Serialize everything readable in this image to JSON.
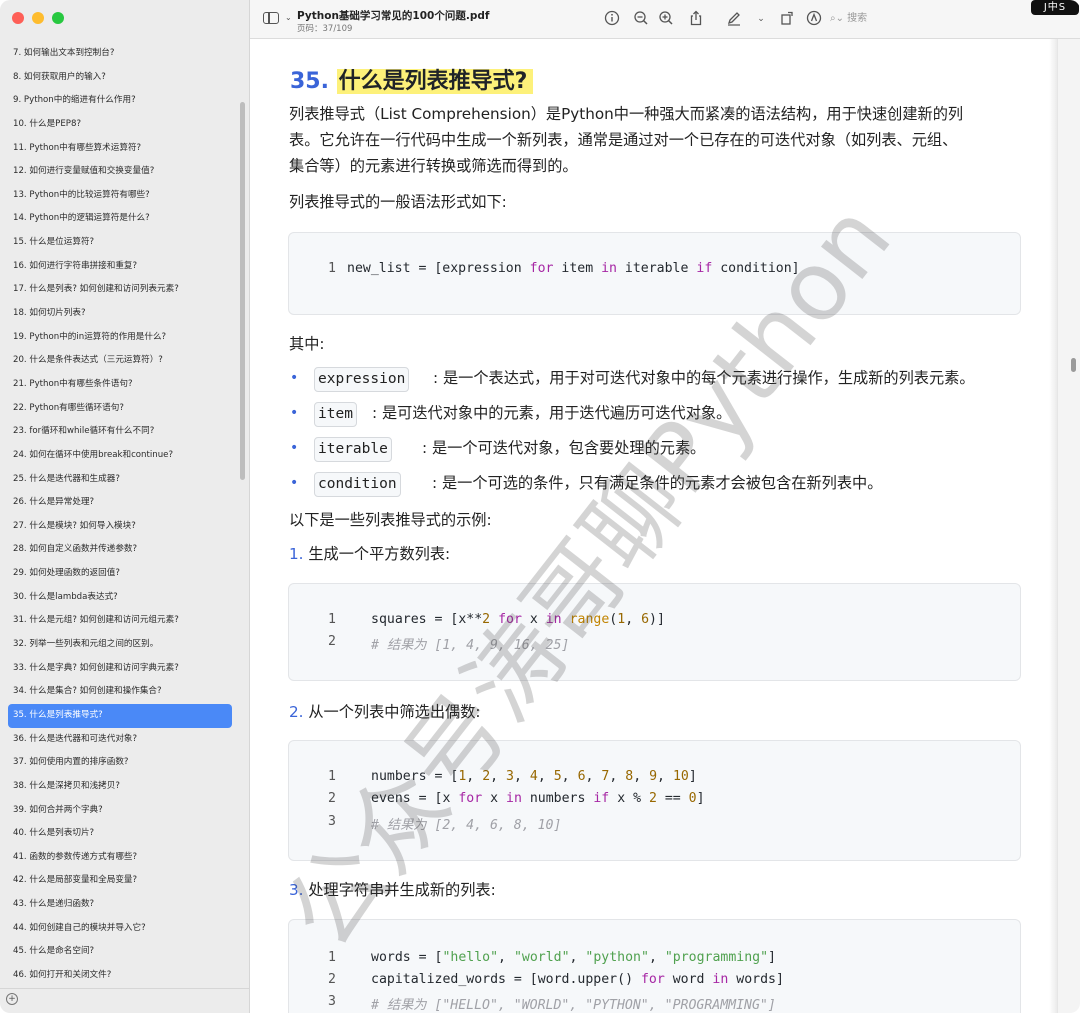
{
  "window": {
    "doc_title": "Python基础学习常见的100个问题.pdf",
    "page_indicator": "页码：37/109",
    "search_placeholder": "搜索",
    "ext_badge": "J中S"
  },
  "sidebar": {
    "items": [
      "7. 如何输出文本到控制台?",
      "8. 如何获取用户的输入?",
      "9. Python中的缩进有什么作用?",
      "10. 什么是PEP8?",
      "11. Python中有哪些算术运算符?",
      "12. 如何进行变量赋值和交换变量值?",
      "13. Python中的比较运算符有哪些?",
      "14. Python中的逻辑运算符是什么?",
      "15. 什么是位运算符?",
      "16. 如何进行字符串拼接和重复?",
      "17. 什么是列表? 如何创建和访问列表元素?",
      "18. 如何切片列表?",
      "19. Python中的in运算符的作用是什么?",
      "20. 什么是条件表达式（三元运算符）?",
      "21. Python中有哪些条件语句?",
      "22. Python有哪些循环语句?",
      "23. for循环和while循环有什么不同?",
      "24. 如何在循环中使用break和continue?",
      "25. 什么是迭代器和生成器?",
      "26. 什么是异常处理?",
      "27. 什么是模块? 如何导入模块?",
      "28. 如何自定义函数并传递参数?",
      "29. 如何处理函数的返回值?",
      "30. 什么是lambda表达式?",
      "31. 什么是元组? 如何创建和访问元组元素?",
      "32. 列举一些列表和元组之间的区别。",
      "33. 什么是字典? 如何创建和访问字典元素?",
      "34. 什么是集合? 如何创建和操作集合?",
      "35. 什么是列表推导式?",
      "36. 什么是迭代器和可迭代对象?",
      "37. 如何使用内置的排序函数?",
      "38. 什么是深拷贝和浅拷贝?",
      "39. 如何合并两个字典?",
      "40. 什么是列表切片?",
      "41. 函数的参数传递方式有哪些?",
      "42. 什么是局部变量和全局变量?",
      "43. 什么是递归函数?",
      "44. 如何创建自己的模块并导入它?",
      "45. 什么是命名空间?",
      "46. 如何打开和关闭文件?"
    ],
    "active_index": 28
  },
  "content": {
    "heading_num": "35.",
    "heading_text": "什么是列表推导式?",
    "intro_line1": "列表推导式（List Comprehension）是Python中一种强大而紧凑的语法结构，用于快速创建新的列",
    "intro_line2": "表。它允许在一行代码中生成一个新列表，通常是通过对一个已存在的可迭代对象（如列表、元组、",
    "intro_line3": "集合等）的元素进行转换或筛选而得到的。",
    "syntax_intro": "列表推导式的一般语法形式如下:",
    "syntax_code": {
      "ln": "1",
      "a": "new_list = [expression ",
      "for": "for",
      "b": " item ",
      "in": "in",
      "c": " iterable ",
      "if": "if",
      "d": " condition]"
    },
    "where_label": "其中:",
    "bullets": [
      {
        "code": "expression",
        "text": ": 是一个表达式，用于对可迭代对象中的每个元素进行操作，生成新的列表元素。"
      },
      {
        "code": "item",
        "text": ": 是可迭代对象中的元素，用于迭代遍历可迭代对象。"
      },
      {
        "code": "iterable",
        "text": ": 是一个可迭代对象，包含要处理的元素。"
      },
      {
        "code": "condition",
        "text": ": 是一个可选的条件，只有满足条件的元素才会被包含在新列表中。"
      }
    ],
    "examples_intro": "以下是一些列表推导式的示例:",
    "example1": {
      "num": "1.",
      "title": "生成一个平方数列表:",
      "l1": {
        "ln": "1",
        "a": "squares = [x",
        "op": "**",
        "n2": "2",
        "sp": " ",
        "for": "for",
        "b": " x ",
        "in": "in",
        "sp2": " ",
        "range": "range",
        "p1": "(",
        "n1": "1",
        "comma": ", ",
        "n6": "6",
        "p2": ")]"
      },
      "l2": {
        "ln": "2",
        "comment": "# 结果为 [1, 4, 9, 16, 25]"
      }
    },
    "example2": {
      "num": "2.",
      "title": "从一个列表中筛选出偶数:",
      "l1": {
        "ln": "1",
        "a": "numbers = [",
        "nums": [
          "1",
          "2",
          "3",
          "4",
          "5",
          "6",
          "7",
          "8",
          "9",
          "10"
        ],
        "z": "]"
      },
      "l2": {
        "ln": "2",
        "a": "evens = [x ",
        "for": "for",
        "b": " x ",
        "in": "in",
        "c": " numbers ",
        "if": "if",
        "d": " x % ",
        "n2": "2",
        "e": " == ",
        "n0": "0",
        "f": "]"
      },
      "l3": {
        "ln": "3",
        "comment": "# 结果为 [2, 4, 6, 8, 10]"
      }
    },
    "example3": {
      "num": "3.",
      "title": "处理字符串并生成新的列表:",
      "l1": {
        "ln": "1",
        "a": "words = [",
        "s1": "\"hello\"",
        "s2": "\"world\"",
        "s3": "\"python\"",
        "s4": "\"programming\"",
        "z": "]"
      },
      "l2": {
        "ln": "2",
        "a": "capitalized_words = [word.upper() ",
        "for": "for",
        "b": " word ",
        "in": "in",
        "c": " words]"
      },
      "l3": {
        "ln": "3",
        "comment": "# 结果为 [\"HELLO\", \"WORLD\", \"PYTHON\", \"PROGRAMMING\"]"
      }
    },
    "watermark": "公众号涛哥聊Python"
  }
}
